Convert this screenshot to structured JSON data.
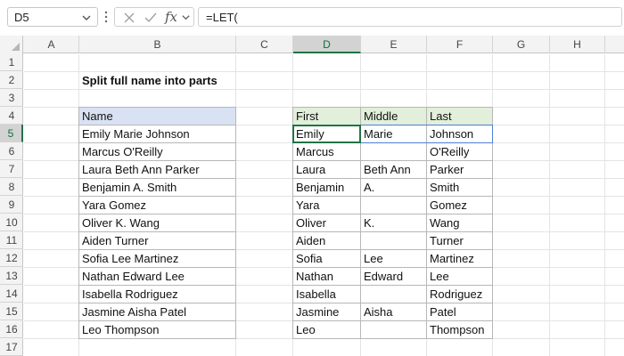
{
  "formula_bar": {
    "name_box": "D5",
    "fx_label": "fx",
    "formula": "=LET("
  },
  "columns": [
    "A",
    "B",
    "C",
    "D",
    "E",
    "F",
    "G",
    "H"
  ],
  "rows": [
    "1",
    "2",
    "3",
    "4",
    "5",
    "6",
    "7",
    "8",
    "9",
    "10",
    "11",
    "12",
    "13",
    "14",
    "15",
    "16",
    "17"
  ],
  "selected_column": "D",
  "selected_row": "5",
  "sheet": {
    "title": "Split full name into parts",
    "names_header": "Name",
    "names": [
      "Emily Marie Johnson",
      "Marcus O'Reilly",
      "Laura Beth Ann Parker",
      "Benjamin A. Smith",
      "Yara Gomez",
      "Oliver K. Wang",
      "Aiden Turner",
      "Sofia Lee Martinez",
      "Nathan Edward Lee",
      "Isabella Rodriguez",
      "Jasmine Aisha Patel",
      "Leo Thompson"
    ],
    "parts_headers": [
      "First",
      "Middle",
      "Last"
    ],
    "parts": [
      [
        "Emily",
        "Marie",
        "Johnson"
      ],
      [
        "Marcus",
        "",
        "O'Reilly"
      ],
      [
        "Laura",
        "Beth Ann",
        "Parker"
      ],
      [
        "Benjamin",
        "A.",
        "Smith"
      ],
      [
        "Yara",
        "",
        "Gomez"
      ],
      [
        "Oliver",
        "K.",
        "Wang"
      ],
      [
        "Aiden",
        "",
        "Turner"
      ],
      [
        "Sofia",
        "Lee",
        "Martinez"
      ],
      [
        "Nathan",
        "Edward",
        "Lee"
      ],
      [
        "Isabella",
        "",
        "Rodriguez"
      ],
      [
        "Jasmine",
        "Aisha",
        "Patel"
      ],
      [
        "Leo",
        "",
        "Thompson"
      ]
    ]
  },
  "colors": {
    "names_header_fill": "#d9e2f3",
    "parts_header_fill": "#e2efda",
    "selection": "#217346"
  },
  "icons": {
    "name_box_dropdown": "chevron-down-icon",
    "more": "vertical-dots-icon",
    "cancel": "close-icon",
    "enter": "check-icon",
    "function": "fx-icon"
  }
}
